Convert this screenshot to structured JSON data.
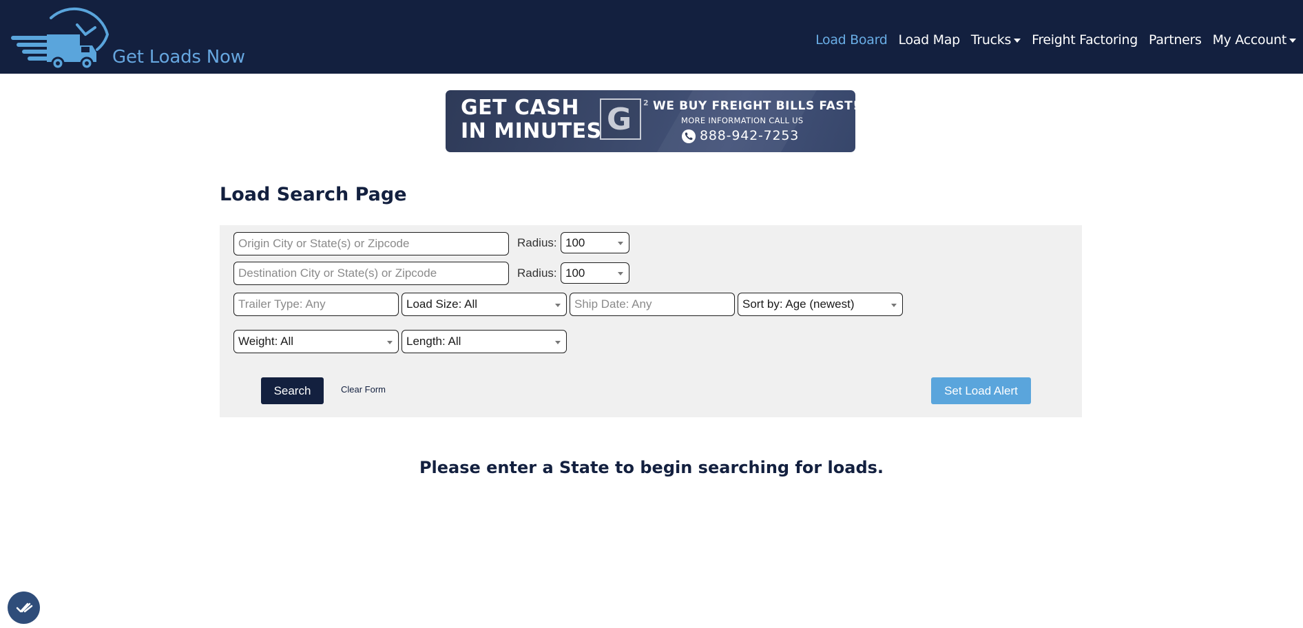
{
  "brand": {
    "name": "Get Loads Now"
  },
  "nav": {
    "items": [
      {
        "label": "Load Board",
        "active": true
      },
      {
        "label": "Load Map"
      },
      {
        "label": "Trucks",
        "dropdown": true
      },
      {
        "label": "Freight Factoring"
      },
      {
        "label": "Partners"
      },
      {
        "label": "My Account",
        "dropdown": true
      }
    ]
  },
  "banner": {
    "line1": "GET CASH",
    "line2": "IN MINUTES",
    "logo_letter": "G",
    "logo_sup": "2",
    "headline": "WE BUY FREIGHT BILLS FAST!",
    "info": "MORE INFORMATION CALL US",
    "phone": "888-942-7253"
  },
  "page": {
    "title": "Load Search Page"
  },
  "search": {
    "origin_placeholder": "Origin City or State(s) or Zipcode",
    "origin_radius_label": "Radius:",
    "origin_radius_value": "100",
    "destination_placeholder": "Destination City or State(s) or Zipcode",
    "destination_radius_label": "Radius:",
    "destination_radius_value": "100",
    "trailer_placeholder": "Trailer Type: Any",
    "load_size": "Load Size: All",
    "ship_date_placeholder": "Ship Date: Any",
    "sort_by": "Sort by: Age (newest)",
    "weight": "Weight: All",
    "length": "Length: All",
    "search_label": "Search",
    "clear_label": "Clear Form",
    "alert_label": "Set Load Alert"
  },
  "message": "Please enter a State to begin searching for loads.",
  "colors": {
    "navbar": "#13203f",
    "accent": "#5aa5dc",
    "panel": "#f0f0f0"
  }
}
